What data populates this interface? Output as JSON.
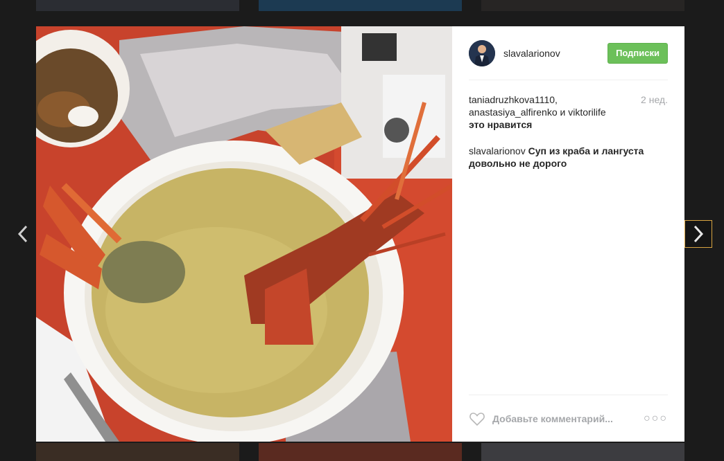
{
  "post": {
    "username": "slavalarionov",
    "follow_label": "Подписки",
    "likes": {
      "names": "taniadruzhkova1110, anastasiya_alfirenko и viktorilife",
      "suffix": "это нравится"
    },
    "time_ago": "2 нед.",
    "caption": {
      "author": "slavalarionov",
      "text": "Суп из краба и лангуста довольно не дорого"
    },
    "comment_placeholder": "Добавьте комментарий...",
    "more_label": "○○○"
  },
  "icons": {
    "prev": "chevron-left-icon",
    "next": "chevron-right-icon",
    "like": "heart-icon",
    "more": "more-options-icon"
  },
  "colors": {
    "follow_button": "#6cc05a",
    "overlay": "#1b1b1b",
    "nav_highlight": "#d9a441"
  }
}
